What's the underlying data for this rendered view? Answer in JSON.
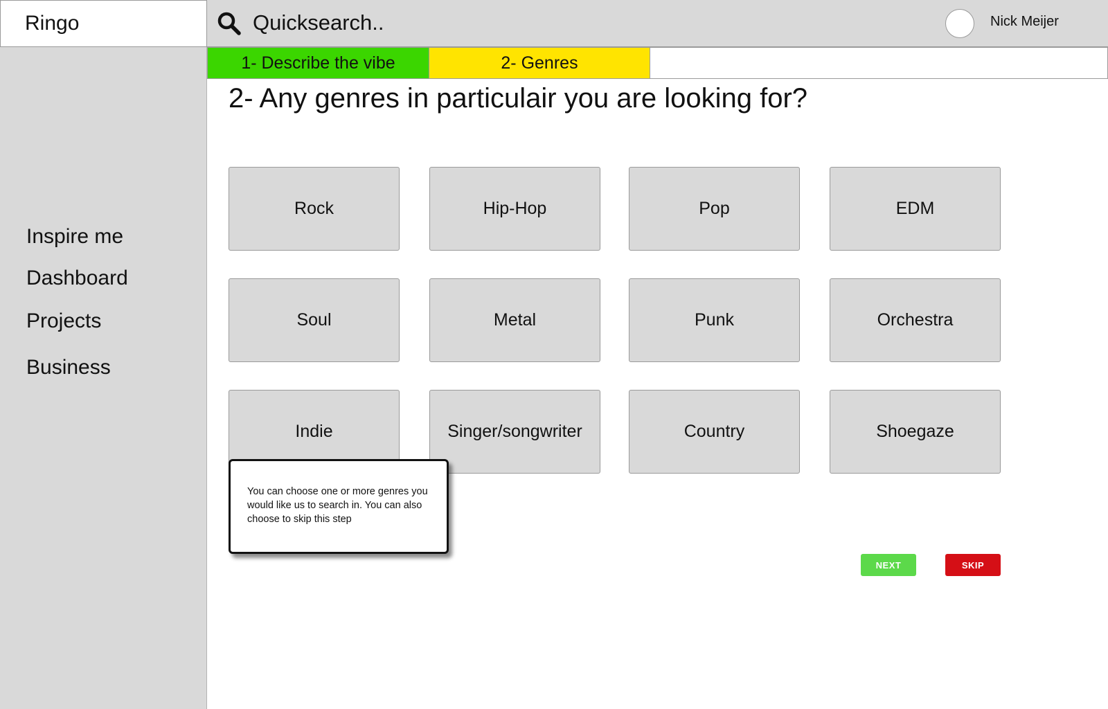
{
  "brand": {
    "name": "Ringo"
  },
  "sidebar": {
    "items": [
      {
        "label": "Inspire me"
      },
      {
        "label": "Dashboard"
      },
      {
        "label": "Projects"
      },
      {
        "label": "Business"
      }
    ]
  },
  "topbar": {
    "search_placeholder": "Quicksearch..",
    "search_icon": "search-icon",
    "user_name": "Nick Meijer"
  },
  "steps": [
    {
      "label": "1- Describe the vibe",
      "color": "#3bd600"
    },
    {
      "label": "2- Genres",
      "color": "#ffe400"
    }
  ],
  "main": {
    "question": "2- Any genres in particulair you are looking for?",
    "genres": [
      "Rock",
      "Hip-Hop",
      "Pop",
      "EDM",
      "Soul",
      "Metal",
      "Punk",
      "Orchestra",
      "Indie",
      "Singer/songwriter",
      "Country",
      "Shoegaze"
    ],
    "tooltip": "You can choose one or more genres you would like us to search in. You can also choose to skip this step",
    "next_label": "NEXT",
    "skip_label": "SKIP"
  },
  "colors": {
    "next": "#5cd94a",
    "skip": "#d50f16",
    "panel": "#d9d9d9"
  }
}
